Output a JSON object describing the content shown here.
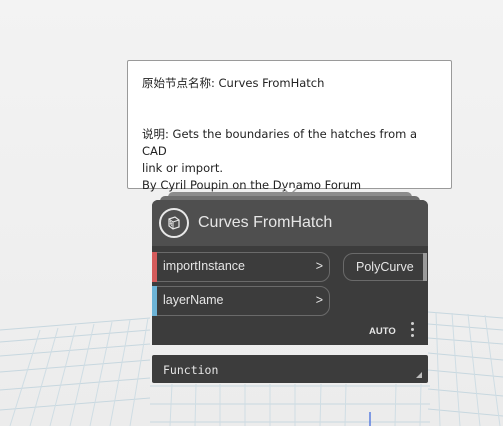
{
  "tooltip": {
    "original_name": "原始节点名称:  Curves FromHatch",
    "description_line1": "说明:  Gets the boundaries of the hatches from a CAD",
    "description_line2": "link or import.",
    "description_line3": "By Cyril Poupin on the Dynamo Forum"
  },
  "node": {
    "title": "Curves FromHatch",
    "icon": "node-package-icon",
    "inputs": [
      {
        "label": "importInstance",
        "chevron": ">",
        "color": "#d45b5b"
      },
      {
        "label": "layerName",
        "chevron": ">",
        "color": "#6cb3d6"
      }
    ],
    "outputs": [
      {
        "label": "PolyCurve"
      }
    ],
    "lacing": "AUTO",
    "function_label": "Function"
  },
  "colors": {
    "node_body": "#3c3c3c",
    "node_header": "#4f4f4f",
    "canvas": "#f1f1f1",
    "grid_line": "#c5dbe6"
  }
}
